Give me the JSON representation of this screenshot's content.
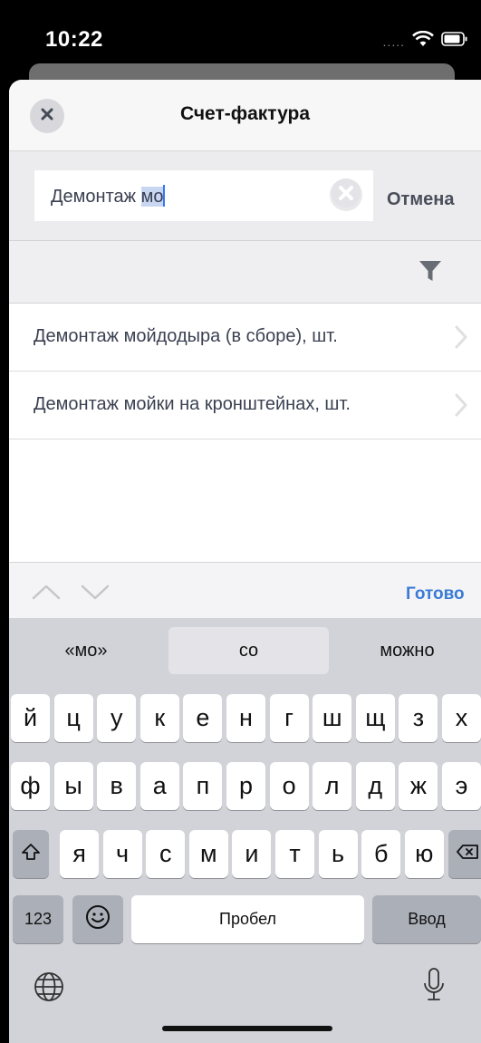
{
  "status": {
    "time": "10:22"
  },
  "nav": {
    "title": "Счет-фактура"
  },
  "search": {
    "value_prefix": "Демонтаж ",
    "value_selected": "мо",
    "cancel_label": "Отмена"
  },
  "results": [
    {
      "label": "Демонтаж мойдодыра (в сборе), шт."
    },
    {
      "label": "Демонтаж мойки на кронштейнах, шт."
    }
  ],
  "keyboard_toolbar": {
    "done_label": "Готово"
  },
  "suggestions": [
    "«мо»",
    "со",
    "можно"
  ],
  "keyboard": {
    "row1": [
      "й",
      "ц",
      "у",
      "к",
      "е",
      "н",
      "г",
      "ш",
      "щ",
      "з",
      "х"
    ],
    "row2": [
      "ф",
      "ы",
      "в",
      "а",
      "п",
      "р",
      "о",
      "л",
      "д",
      "ж",
      "э"
    ],
    "row3": [
      "я",
      "ч",
      "с",
      "м",
      "и",
      "т",
      "ь",
      "б",
      "ю"
    ],
    "numbers_label": "123",
    "space_label": "Пробел",
    "return_label": "Ввод"
  },
  "colors": {
    "accent": "#3a7bd5",
    "caret": "#3478f6",
    "selection": "#c9d6f2"
  },
  "icons": [
    "close-icon",
    "clear-icon",
    "filter-icon",
    "chevron-right-icon",
    "chevron-up-icon",
    "chevron-down-icon",
    "shift-icon",
    "backspace-icon",
    "emoji-icon",
    "globe-icon",
    "microphone-icon",
    "wifi-icon",
    "battery-icon"
  ]
}
